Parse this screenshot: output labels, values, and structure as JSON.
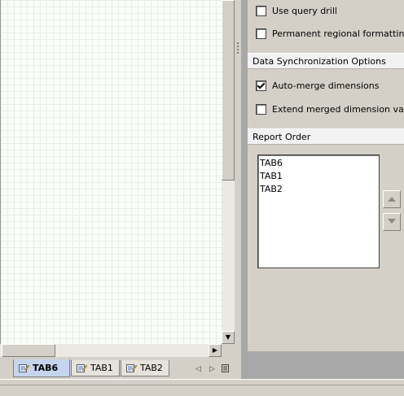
{
  "options": {
    "use_query_drill": {
      "label": "Use query drill",
      "checked": false
    },
    "permanent_regional_formatting": {
      "label": "Permanent regional formatting",
      "checked": false
    }
  },
  "sync_section": {
    "title": "Data Synchronization Options",
    "auto_merge": {
      "label": "Auto-merge dimensions",
      "checked": true
    },
    "extend_merged": {
      "label": "Extend merged dimension values",
      "checked": false
    }
  },
  "report_order": {
    "title": "Report Order",
    "items": [
      "TAB6",
      "TAB1",
      "TAB2"
    ]
  },
  "tabs": [
    {
      "label": "TAB6",
      "active": true
    },
    {
      "label": "TAB1",
      "active": false
    },
    {
      "label": "TAB2",
      "active": false
    }
  ],
  "icons": {
    "tab": "report-tab-icon",
    "nav_prev": "triangle-left-icon",
    "nav_next": "triangle-right-icon",
    "nav_list": "tab-list-icon",
    "move_up": "arrow-up-icon",
    "move_down": "arrow-down-icon"
  },
  "colors": {
    "active_tab": "#c5d5ee",
    "panel_bg": "#d4d0c8",
    "grid_line": "#e6efe6"
  }
}
